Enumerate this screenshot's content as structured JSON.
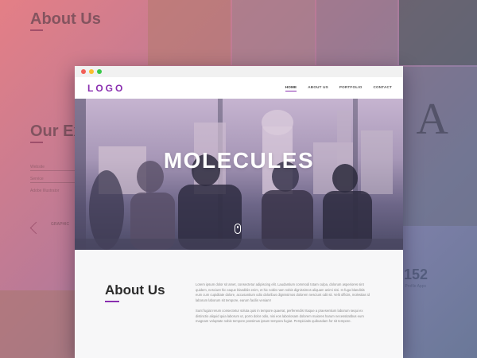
{
  "background": {
    "about_heading": "About Us",
    "experience_heading": "Our Ex",
    "form_labels": [
      "Website",
      "Service",
      "Adobe Illustrator"
    ],
    "service_label": "GRAPHIC",
    "stat_number": "152",
    "stat_label": "Profile Apps",
    "letter": "A"
  },
  "window": {
    "titlebar_dots": [
      "#f25f58",
      "#fbbe2e",
      "#38c94a"
    ],
    "logo": "LOGO",
    "nav": [
      {
        "label": "HOME",
        "active": true
      },
      {
        "label": "ABOUT US",
        "active": false
      },
      {
        "label": "PORTFOLIO",
        "active": false
      },
      {
        "label": "CONTACT",
        "active": false
      }
    ],
    "hero_title": "MOLECULES",
    "scroll_icon": "mouse-icon",
    "about_title": "About Us",
    "paragraphs": [
      "Lorem ipsum dolor sit amet, consectetur adipiscing elit. Laudantium commodi totam culpa, dolorum asperiores sint quidem, nesciunt hic eaque blanditiis enim, et hic nobis nam nobis dignissimos aliquam animi nisi. In fuga blanditiis eum cum cupiditate dolore, accusantium odio doloribus dignissimos dolorem nesciunt odit sit. Velit officiis, molestias id laborum laborum sit tempore, earum facilis veniam!",
      "Sunt fugiat rerum consectetur soluta quis in tempore quaerat, perferendis! Itaque a praesentium laborum sequi ex distinctio aliquid quia laborum ut, porro dolor odio, nisi eos laboriosam dolorem maiores harum necessitatibus eum magnam voluptate nobis tempore possimus ipsam tempora fugiat. Perspiciatis quibusdam for sit tempore."
    ],
    "accent_color": "#8a2fb0"
  }
}
